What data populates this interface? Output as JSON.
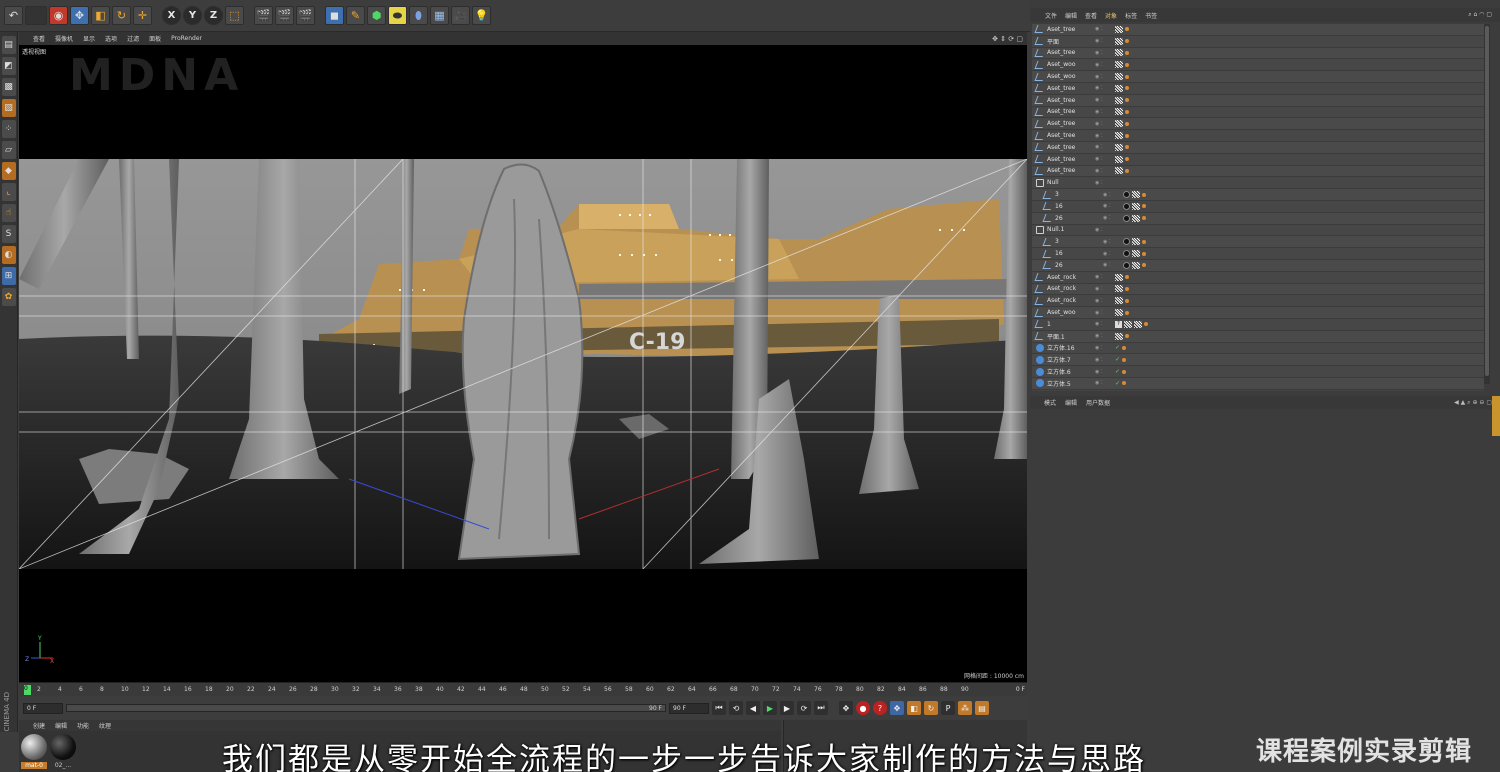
{
  "app": {
    "brand_watermark": "MDNA"
  },
  "viewport": {
    "menu": [
      "查看",
      "摄像机",
      "显示",
      "选项",
      "过滤",
      "面板",
      "ProRender"
    ],
    "title": "透视视图",
    "grid_distance": "网格间距 : 10000 cm",
    "axis_labels": {
      "y": "Y",
      "z": "Z",
      "x": "X"
    }
  },
  "timeline": {
    "ticks": [
      "2",
      "4",
      "6",
      "8",
      "10",
      "12",
      "14",
      "16",
      "18",
      "20",
      "22",
      "24",
      "26",
      "28",
      "30",
      "32",
      "34",
      "36",
      "38",
      "40",
      "42",
      "44",
      "46",
      "48",
      "50",
      "52",
      "54",
      "56",
      "58",
      "60",
      "62",
      "64",
      "66",
      "68",
      "70",
      "72",
      "74",
      "76",
      "78",
      "80",
      "82",
      "84",
      "86",
      "88",
      "90"
    ],
    "current_marker": "0",
    "frame_display": "0 F",
    "start_field": "0 F",
    "end_field": "90 F",
    "slider_end": "90 F"
  },
  "materials": {
    "menu": [
      "创建",
      "编辑",
      "功能",
      "纹理"
    ],
    "items": [
      {
        "label": "mat-0",
        "selected": true
      },
      {
        "label": "02_...",
        "selected": false
      }
    ]
  },
  "object_manager": {
    "menu": [
      "文件",
      "编辑",
      "查看",
      "对象",
      "标签",
      "书签"
    ],
    "active_menu": "对象",
    "rows": [
      {
        "name": "Aset_tree",
        "type": "spline",
        "tags": "x",
        "depth": 0
      },
      {
        "name": "平面",
        "type": "spline",
        "tags": "x",
        "depth": 0
      },
      {
        "name": "Aset_tree",
        "type": "spline",
        "tags": "x",
        "depth": 0
      },
      {
        "name": "Aset_woo",
        "type": "spline",
        "tags": "x",
        "depth": 0
      },
      {
        "name": "Aset_woo",
        "type": "spline",
        "tags": "x",
        "depth": 0
      },
      {
        "name": "Aset_tree",
        "type": "spline",
        "tags": "x",
        "depth": 0
      },
      {
        "name": "Aset_tree",
        "type": "spline",
        "tags": "x",
        "depth": 0
      },
      {
        "name": "Aset_tree",
        "type": "spline",
        "tags": "x",
        "depth": 0
      },
      {
        "name": "Aset_tree",
        "type": "spline",
        "tags": "x",
        "depth": 0
      },
      {
        "name": "Aset_tree",
        "type": "spline",
        "tags": "x",
        "depth": 0
      },
      {
        "name": "Aset_tree",
        "type": "spline",
        "tags": "x",
        "depth": 0
      },
      {
        "name": "Aset_tree",
        "type": "spline",
        "tags": "x",
        "depth": 0
      },
      {
        "name": "Aset_tree",
        "type": "spline",
        "tags": "x",
        "depth": 0
      },
      {
        "name": "Null",
        "type": "null",
        "tags": "",
        "depth": 0
      },
      {
        "name": "3",
        "type": "spline",
        "tags": "bx",
        "depth": 1
      },
      {
        "name": "16",
        "type": "spline",
        "tags": "bx",
        "depth": 1
      },
      {
        "name": "26",
        "type": "spline",
        "tags": "bx",
        "depth": 1
      },
      {
        "name": "Null.1",
        "type": "null",
        "tags": "",
        "depth": 0
      },
      {
        "name": "3",
        "type": "spline",
        "tags": "bx",
        "depth": 1
      },
      {
        "name": "16",
        "type": "spline",
        "tags": "bx",
        "depth": 1
      },
      {
        "name": "26",
        "type": "spline",
        "tags": "bx",
        "depth": 1
      },
      {
        "name": "Aset_rock",
        "type": "spline",
        "tags": "x",
        "depth": 0
      },
      {
        "name": "Aset_rock",
        "type": "spline",
        "tags": "x",
        "depth": 0
      },
      {
        "name": "Aset_rock",
        "type": "spline",
        "tags": "x",
        "depth": 0
      },
      {
        "name": "Aset_woo",
        "type": "spline",
        "tags": "x",
        "depth": 0
      },
      {
        "name": "1",
        "type": "spline",
        "tags": "qxx",
        "depth": 0
      },
      {
        "name": "平面.1",
        "type": "spline",
        "tags": "x",
        "depth": 0
      },
      {
        "name": "立方体.16",
        "type": "cube",
        "tags": "c",
        "depth": 0
      },
      {
        "name": "立方体.7",
        "type": "cube",
        "tags": "c",
        "depth": 0
      },
      {
        "name": "立方体.6",
        "type": "cube",
        "tags": "c",
        "depth": 0
      },
      {
        "name": "立方体.5",
        "type": "cube",
        "tags": "c",
        "depth": 0
      }
    ]
  },
  "attribute_manager": {
    "menu": [
      "模式",
      "编辑",
      "用户数据"
    ]
  },
  "subtitle": "我们都是从零开始全流程的一步一步告诉大家制作的方法与思路",
  "brand_overlay": "课程案例实录剪辑",
  "colors": {
    "sky": "#8e8e8e",
    "ground": "#1f1f1f",
    "ship": "#c9a15a",
    "accent": "#c67d2b",
    "play": "#4cd964"
  },
  "side_label": "CINEMA 4D"
}
